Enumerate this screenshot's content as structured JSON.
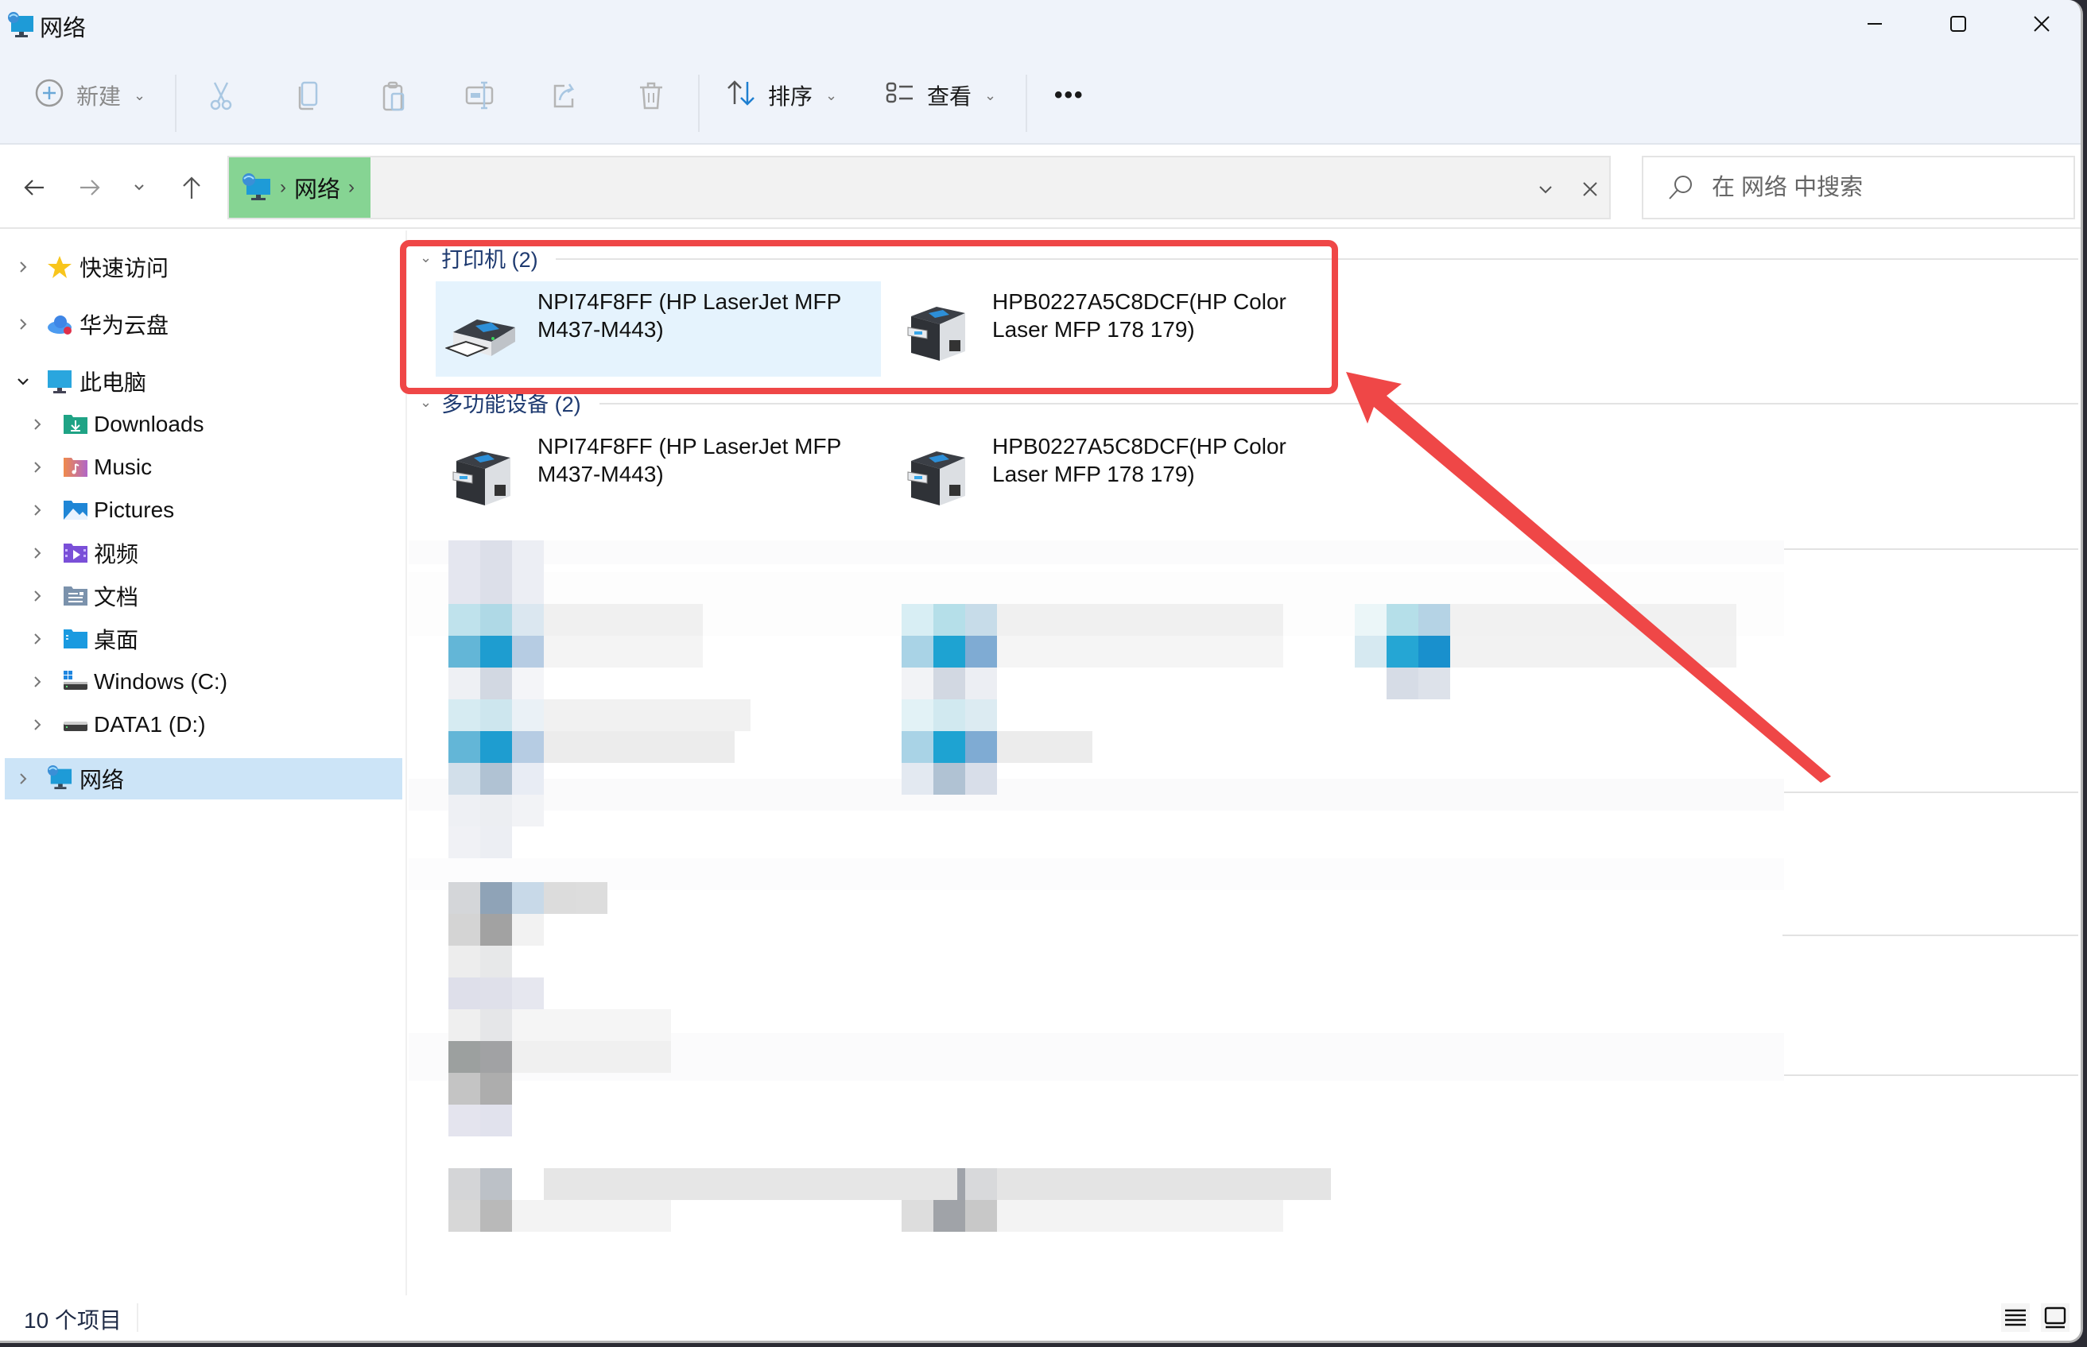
{
  "window": {
    "title": "网络",
    "controls": {
      "minimize": "minimize",
      "maximize": "maximize",
      "close": "close"
    }
  },
  "toolbar": {
    "new_label": "新建",
    "sort_label": "排序",
    "view_label": "查看",
    "more_label": "•••",
    "icons": [
      "plus-circle-icon",
      "cut-icon",
      "copy-icon",
      "paste-icon",
      "rename-icon",
      "share-icon",
      "delete-icon",
      "sort-icon",
      "view-icon",
      "more-icon"
    ]
  },
  "address": {
    "root_icon": "network-icon",
    "crumbs": [
      "网络"
    ],
    "separator": "›"
  },
  "search": {
    "placeholder": "在 网络 中搜索",
    "value": ""
  },
  "sidebar": {
    "items": [
      {
        "label": "快速访问",
        "icon": "star-icon",
        "expanded": false,
        "level": 0
      },
      {
        "label": "华为云盘",
        "icon": "cloud-icon",
        "expanded": false,
        "level": 0
      },
      {
        "label": "此电脑",
        "icon": "computer-icon",
        "expanded": true,
        "level": 0
      },
      {
        "label": "Downloads",
        "icon": "downloads-folder-icon",
        "expanded": false,
        "level": 1
      },
      {
        "label": "Music",
        "icon": "music-folder-icon",
        "expanded": false,
        "level": 1
      },
      {
        "label": "Pictures",
        "icon": "pictures-folder-icon",
        "expanded": false,
        "level": 1
      },
      {
        "label": "视频",
        "icon": "videos-folder-icon",
        "expanded": false,
        "level": 1
      },
      {
        "label": "文档",
        "icon": "documents-folder-icon",
        "expanded": false,
        "level": 1
      },
      {
        "label": "桌面",
        "icon": "desktop-folder-icon",
        "expanded": false,
        "level": 1
      },
      {
        "label": "Windows (C:)",
        "icon": "windows-drive-icon",
        "expanded": false,
        "level": 1
      },
      {
        "label": "DATA1 (D:)",
        "icon": "drive-icon",
        "expanded": false,
        "level": 1
      },
      {
        "label": "网络",
        "icon": "network-icon",
        "expanded": false,
        "level": 0,
        "selected": true
      }
    ]
  },
  "content": {
    "groups": [
      {
        "label": "打印机 (2)",
        "items": [
          {
            "line1": "NPI74F8FF (HP LaserJet MFP",
            "line2": "M437-M443)",
            "icon": "printer-icon",
            "selected": true
          },
          {
            "line1": "HPB0227A5C8DCF(HP Color",
            "line2": "Laser MFP 178 179)",
            "icon": "mfp-printer-icon",
            "selected": false
          }
        ]
      },
      {
        "label": "多功能设备 (2)",
        "items": [
          {
            "line1": "NPI74F8FF (HP LaserJet MFP",
            "line2": "M437-M443)",
            "icon": "mfp-printer-icon",
            "selected": false
          },
          {
            "line1": "HPB0227A5C8DCF(HP Color",
            "line2": "Laser MFP 178 179)",
            "icon": "mfp-printer-icon",
            "selected": false
          }
        ]
      }
    ],
    "blurred_note": "remaining items pixelated/obscured"
  },
  "status": {
    "item_count": "10 个项目"
  },
  "view_toggle": {
    "details": "details-view-icon",
    "tiles": "tiles-view-icon"
  },
  "annotation": {
    "color": "#ef4747",
    "target": "打印机 (2)"
  },
  "colors": {
    "chrome_bg": "#eff3fa",
    "selection": "#cce4f7",
    "tile_selected": "#e5f3fd",
    "breadcrumb_highlight": "#86d493",
    "group_header": "#1e3a70",
    "annotation_red": "#ef4747"
  }
}
